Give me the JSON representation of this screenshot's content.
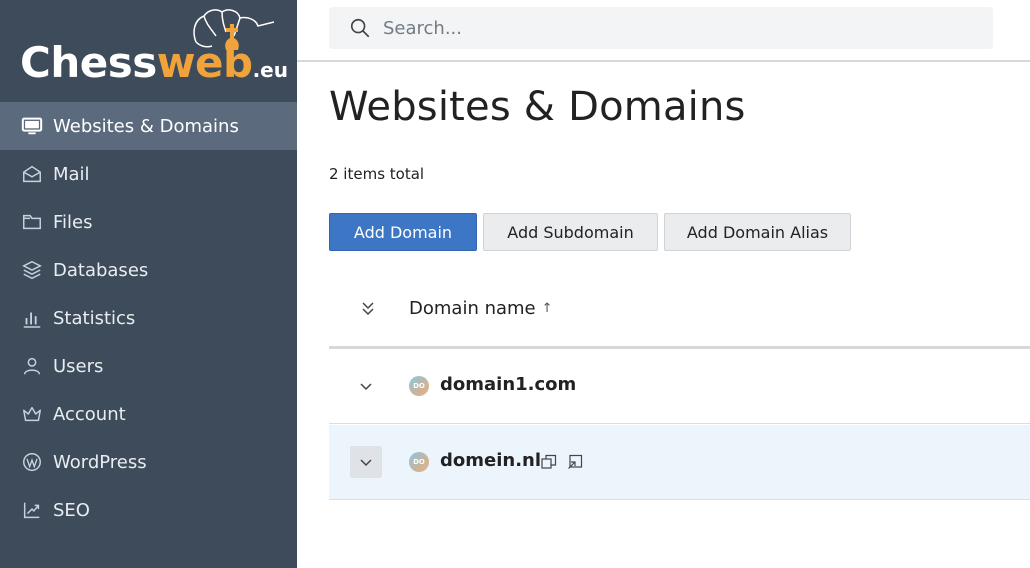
{
  "logo": {
    "part1": "Chess",
    "part2": "web",
    "part3": ".eu"
  },
  "sidebar": {
    "items": [
      {
        "label": "Websites & Domains",
        "icon": "monitor-icon",
        "active": true
      },
      {
        "label": "Mail",
        "icon": "envelope-icon"
      },
      {
        "label": "Files",
        "icon": "folder-icon"
      },
      {
        "label": "Databases",
        "icon": "database-icon"
      },
      {
        "label": "Statistics",
        "icon": "bar-chart-icon"
      },
      {
        "label": "Users",
        "icon": "user-icon"
      },
      {
        "label": "Account",
        "icon": "crown-icon"
      },
      {
        "label": "WordPress",
        "icon": "wordpress-icon"
      },
      {
        "label": "SEO",
        "icon": "trend-icon"
      }
    ]
  },
  "search": {
    "placeholder": "Search..."
  },
  "main": {
    "title": "Websites & Domains",
    "items_total": "2 items total",
    "buttons": {
      "add_domain": "Add Domain",
      "add_subdomain": "Add Subdomain",
      "add_alias": "Add Domain Alias"
    },
    "table": {
      "header": {
        "domain_name": "Domain name",
        "sort_indicator": "↑"
      },
      "rows": [
        {
          "favicon_text": "DO",
          "name": "domain1.com"
        },
        {
          "favicon_text": "DO",
          "name": "domein.nl"
        }
      ]
    }
  },
  "colors": {
    "sidebar_bg": "#3e4b5a",
    "sidebar_active": "#5b6a7c",
    "primary_button": "#3d76c5",
    "logo_accent": "#f0a23b",
    "selected_row": "#edf5fc"
  }
}
